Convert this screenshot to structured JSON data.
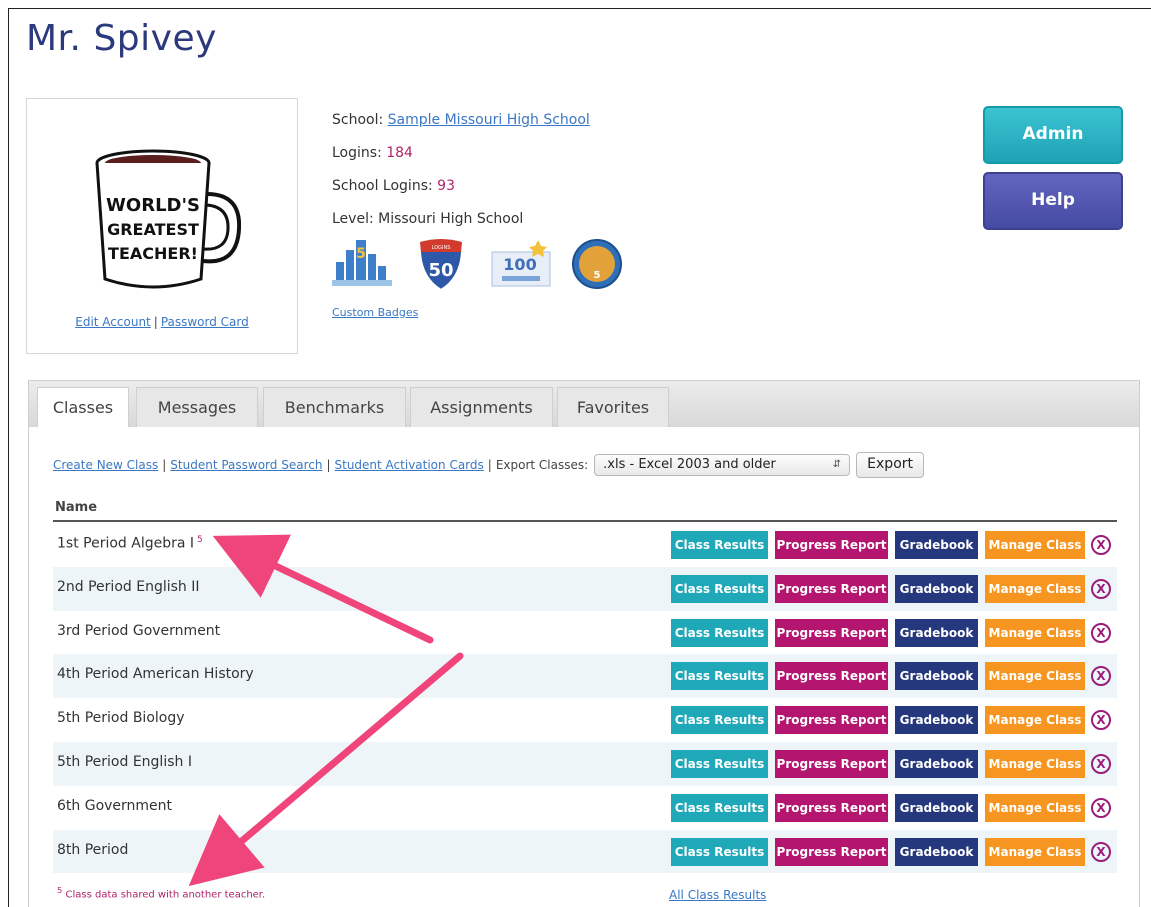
{
  "page": {
    "title": "Mr. Spivey"
  },
  "profile": {
    "mug_text": [
      "WORLD'S",
      "GREATEST",
      "TEACHER!"
    ],
    "edit_account": "Edit Account",
    "separator": "|",
    "password_card": "Password Card"
  },
  "info": {
    "school_label": "School:",
    "school_value": "Sample Missouri High School",
    "logins_label": "Logins:",
    "logins_value": "184",
    "school_logins_label": "School Logins:",
    "school_logins_value": "93",
    "level_label": "Level:",
    "level_value": "Missouri High School",
    "badges": [
      {
        "icon": "bar-chart-badge-icon",
        "text": "5"
      },
      {
        "icon": "interstate-shield-badge-icon",
        "top": "LOGINS",
        "text": "50"
      },
      {
        "icon": "100-completion-badge-icon",
        "text": "100"
      },
      {
        "icon": "globe-badge-icon",
        "text": "5"
      }
    ],
    "custom_badges": "Custom Badges"
  },
  "side_buttons": {
    "admin": "Admin",
    "help": "Help"
  },
  "tabs": [
    "Classes",
    "Messages",
    "Benchmarks",
    "Assignments",
    "Favorites"
  ],
  "toolbar": {
    "create_new_class": "Create New Class",
    "student_password_search": "Student Password Search",
    "student_activation_cards": "Student Activation Cards",
    "export_label": "Export Classes:",
    "export_format": ".xls - Excel 2003 and older",
    "export_button": "Export",
    "sep": "|"
  },
  "table": {
    "header": "Name",
    "button_labels": {
      "results": "Class Results",
      "progress": "Progress Report",
      "gradebook": "Gradebook",
      "manage": "Manage Class",
      "delete": "X"
    },
    "rows": [
      {
        "name": "1st Period Algebra I",
        "mark": "5"
      },
      {
        "name": "2nd Period English II",
        "mark": ""
      },
      {
        "name": "3rd Period Government",
        "mark": ""
      },
      {
        "name": "4th Period American History",
        "mark": ""
      },
      {
        "name": "5th Period Biology",
        "mark": ""
      },
      {
        "name": "5th Period English I",
        "mark": ""
      },
      {
        "name": "6th Government",
        "mark": ""
      },
      {
        "name": "8th Period",
        "mark": ""
      }
    ]
  },
  "footnote": {
    "mark": "5",
    "text": "Class data shared with another teacher."
  },
  "all_class_results": "All Class Results",
  "colors": {
    "title": "#2b3a7d",
    "link": "#3b77c3",
    "accent_magenta": "#b3156f",
    "teal": "#1ea8b8",
    "navy": "#26387d",
    "orange": "#f6951f",
    "arrow": "#f0457b"
  }
}
